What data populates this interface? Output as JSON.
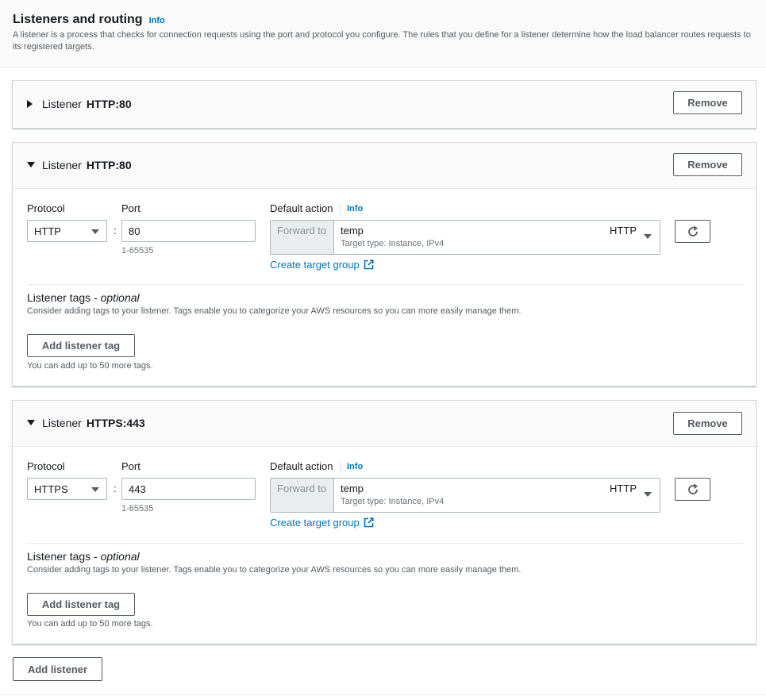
{
  "header": {
    "title": "Listeners and routing",
    "info": "Info",
    "description": "A listener is a process that checks for connection requests using the port and protocol you configure. The rules that you define for a listener determine how the load balancer routes requests to its registered targets."
  },
  "listeners": [
    {
      "label": "Listener",
      "value": "HTTP:80",
      "remove": "Remove"
    },
    {
      "label": "Listener",
      "value": "HTTP:80",
      "remove": "Remove",
      "protocol_label": "Protocol",
      "protocol": "HTTP",
      "port_label": "Port",
      "port": "80",
      "port_hint": "1-65535",
      "action_label": "Default action",
      "action_info": "Info",
      "forward_to": "Forward to",
      "target_name": "temp",
      "target_type": "Target type: Instance, IPv4",
      "target_protocol": "HTTP",
      "create_tg": "Create target group",
      "tags_title": "Listener tags - ",
      "tags_optional": "optional",
      "tags_desc": "Consider adding tags to your listener. Tags enable you to categorize your AWS resources so you can more easily manage them.",
      "add_tag": "Add listener tag",
      "tags_hint": "You can add up to 50 more tags."
    },
    {
      "label": "Listener",
      "value": "HTTPS:443",
      "remove": "Remove",
      "protocol_label": "Protocol",
      "protocol": "HTTPS",
      "port_label": "Port",
      "port": "443",
      "port_hint": "1-65535",
      "action_label": "Default action",
      "action_info": "Info",
      "forward_to": "Forward to",
      "target_name": "temp",
      "target_type": "Target type: Instance, IPv4",
      "target_protocol": "HTTP",
      "create_tg": "Create target group",
      "tags_title": "Listener tags - ",
      "tags_optional": "optional",
      "tags_desc": "Consider adding tags to your listener. Tags enable you to categorize your AWS resources so you can more easily manage them.",
      "add_tag": "Add listener tag",
      "tags_hint": "You can add up to 50 more tags."
    }
  ],
  "add_listener": "Add listener",
  "icons": {
    "refresh": "refresh-icon",
    "external": "external-link-icon",
    "caret_right": "caret-right-icon",
    "caret_down": "caret-down-icon"
  },
  "colors": {
    "link": "#0073bb",
    "text": "#16191f",
    "border": "#aab7b8"
  }
}
